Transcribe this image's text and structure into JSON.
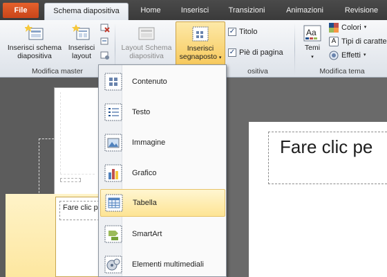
{
  "tabs": [
    {
      "label": "File"
    },
    {
      "label": "Schema diapositiva"
    },
    {
      "label": "Home"
    },
    {
      "label": "Inserisci"
    },
    {
      "label": "Transizioni"
    },
    {
      "label": "Animazioni"
    },
    {
      "label": "Revisione"
    }
  ],
  "ribbon": {
    "insert_master": "Inserisci schema\ndiapositiva",
    "insert_layout": "Inserisci\nlayout",
    "group_master": "Modifica master",
    "layout_master": "Layout Schema\ndiapositiva",
    "insert_placeholder": "Inserisci\nsegnaposto",
    "title_check": "Titolo",
    "footer_check": "Piè di pagina",
    "group_layout_partial": "ositiva",
    "themes": "Temi",
    "colors": "Colori",
    "fonts": "Tipi di caratte",
    "effects": "Effetti",
    "group_theme": "Modifica tema"
  },
  "menu": {
    "items": [
      {
        "label": "Contenuto",
        "icon": "content-placeholder-icon"
      },
      {
        "label": "Testo",
        "icon": "text-placeholder-icon"
      },
      {
        "label": "Immagine",
        "icon": "picture-placeholder-icon"
      },
      {
        "label": "Grafico",
        "icon": "chart-placeholder-icon"
      },
      {
        "label": "Tabella",
        "icon": "table-placeholder-icon"
      },
      {
        "label": "SmartArt",
        "icon": "smartart-placeholder-icon"
      },
      {
        "label": "Elementi multimediali",
        "icon": "media-placeholder-icon"
      }
    ],
    "hovered_index": 4
  },
  "slides": {
    "thumb_title": "Fare clic p",
    "main_title": "Fare clic pe"
  },
  "colors": {
    "file_tab": "#d24f22",
    "hover_item": "#fde494",
    "pressed_button": "#f7c95c"
  }
}
